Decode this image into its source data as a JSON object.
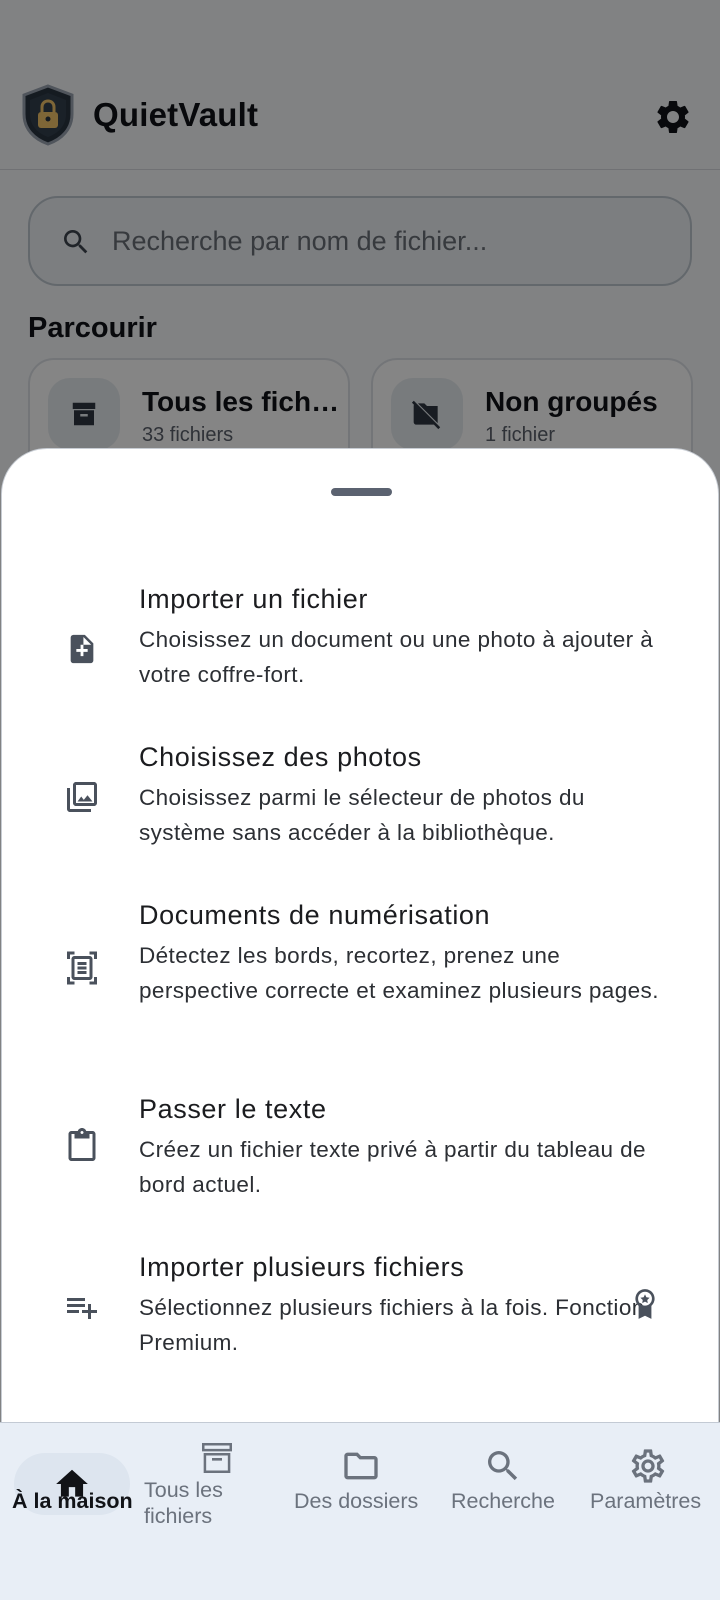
{
  "app": {
    "title": "QuietVault",
    "accent": "#5b6270"
  },
  "search": {
    "placeholder": "Recherche par nom de fichier..."
  },
  "browse": {
    "title": "Parcourir",
    "cards": [
      {
        "title": "Tous les fichi…",
        "subtitle": "33 fichiers",
        "icon": "archive-icon"
      },
      {
        "title": "Non groupés",
        "subtitle": "1 fichier",
        "icon": "folder-off-icon"
      }
    ]
  },
  "sheet": {
    "options": [
      {
        "title": "Importer un fichier",
        "description": "Choisissez un document ou une photo à ajouter à votre coffre-fort.",
        "icon": "file-add-icon"
      },
      {
        "title": "Choisissez des photos",
        "description": "Choisissez parmi le sélecteur de photos du système sans accéder à la bibliothèque.",
        "icon": "photo-library-icon"
      },
      {
        "title": "Documents de numérisation",
        "description": "Détectez les bords, recortez, prenez une perspective correcte et examinez plusieurs pages.",
        "icon": "document-scanner-icon"
      },
      {
        "title": "Passer le texte",
        "description": "Créez un fichier texte privé à partir du tableau de bord actuel.",
        "icon": "clipboard-icon"
      },
      {
        "title": "Importer plusieurs fichiers",
        "description": "Sélectionnez plusieurs fichiers à la fois. Fonction Premium.",
        "icon": "playlist-add-icon",
        "badge": "premium-badge-icon"
      }
    ]
  },
  "nav": {
    "items": [
      {
        "label": "À la maison",
        "icon": "home-icon",
        "active": true
      },
      {
        "label": "Tous les fichiers",
        "icon": "archive-icon",
        "active": false
      },
      {
        "label": "Des dossiers",
        "icon": "folder-icon",
        "active": false
      },
      {
        "label": "Recherche",
        "icon": "search-icon",
        "active": false
      },
      {
        "label": "Paramètres",
        "icon": "settings-icon",
        "active": false
      }
    ]
  }
}
